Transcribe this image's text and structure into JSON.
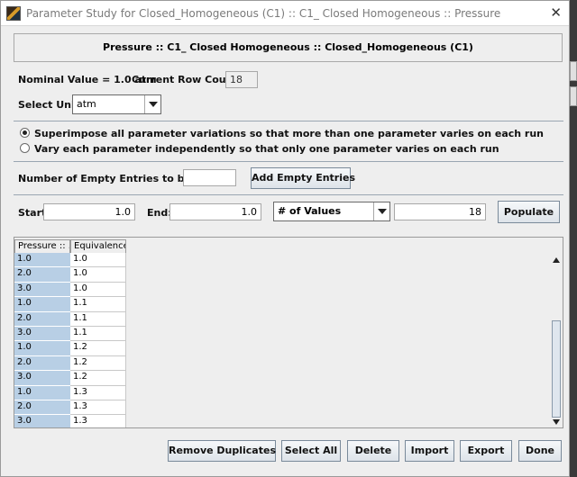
{
  "window": {
    "title": "Parameter Study for Closed_Homogeneous (C1) :: C1_ Closed Homogeneous :: Pressure",
    "close_glyph": "✕"
  },
  "header": {
    "text": "Pressure :: C1_ Closed Homogeneous :: Closed_Homogeneous (C1)"
  },
  "nominal": {
    "label": "Nominal Value = 1.0 atm",
    "row_count_label": "Current Row Count =",
    "row_count": "18"
  },
  "unit": {
    "label": "Select Unit:",
    "value": "atm"
  },
  "mode": {
    "options": [
      {
        "label": "Superimpose all parameter variations so that more than one parameter varies on each run",
        "selected": true
      },
      {
        "label": "Vary each parameter independently so that only one parameter varies on each run",
        "selected": false
      }
    ]
  },
  "empty_entries": {
    "label": "Number of Empty Entries to be Added:",
    "value": "",
    "button": "Add Empty Entries"
  },
  "range": {
    "start_label": "Start:",
    "start": "1.0",
    "end_label": "End:",
    "end": "1.0",
    "mode": "# of Values",
    "count": "18",
    "populate_button": "Populate"
  },
  "table": {
    "columns": [
      "Pressure :: ...",
      "Equivalence ..."
    ],
    "rows": [
      [
        "1.0",
        "1.0"
      ],
      [
        "2.0",
        "1.0"
      ],
      [
        "3.0",
        "1.0"
      ],
      [
        "1.0",
        "1.1"
      ],
      [
        "2.0",
        "1.1"
      ],
      [
        "3.0",
        "1.1"
      ],
      [
        "1.0",
        "1.2"
      ],
      [
        "2.0",
        "1.2"
      ],
      [
        "3.0",
        "1.2"
      ],
      [
        "1.0",
        "1.3"
      ],
      [
        "2.0",
        "1.3"
      ],
      [
        "3.0",
        "1.3"
      ]
    ]
  },
  "footer": {
    "buttons": [
      "Remove Duplicates",
      "Select All",
      "Delete",
      "Import",
      "Export",
      "Done"
    ]
  }
}
